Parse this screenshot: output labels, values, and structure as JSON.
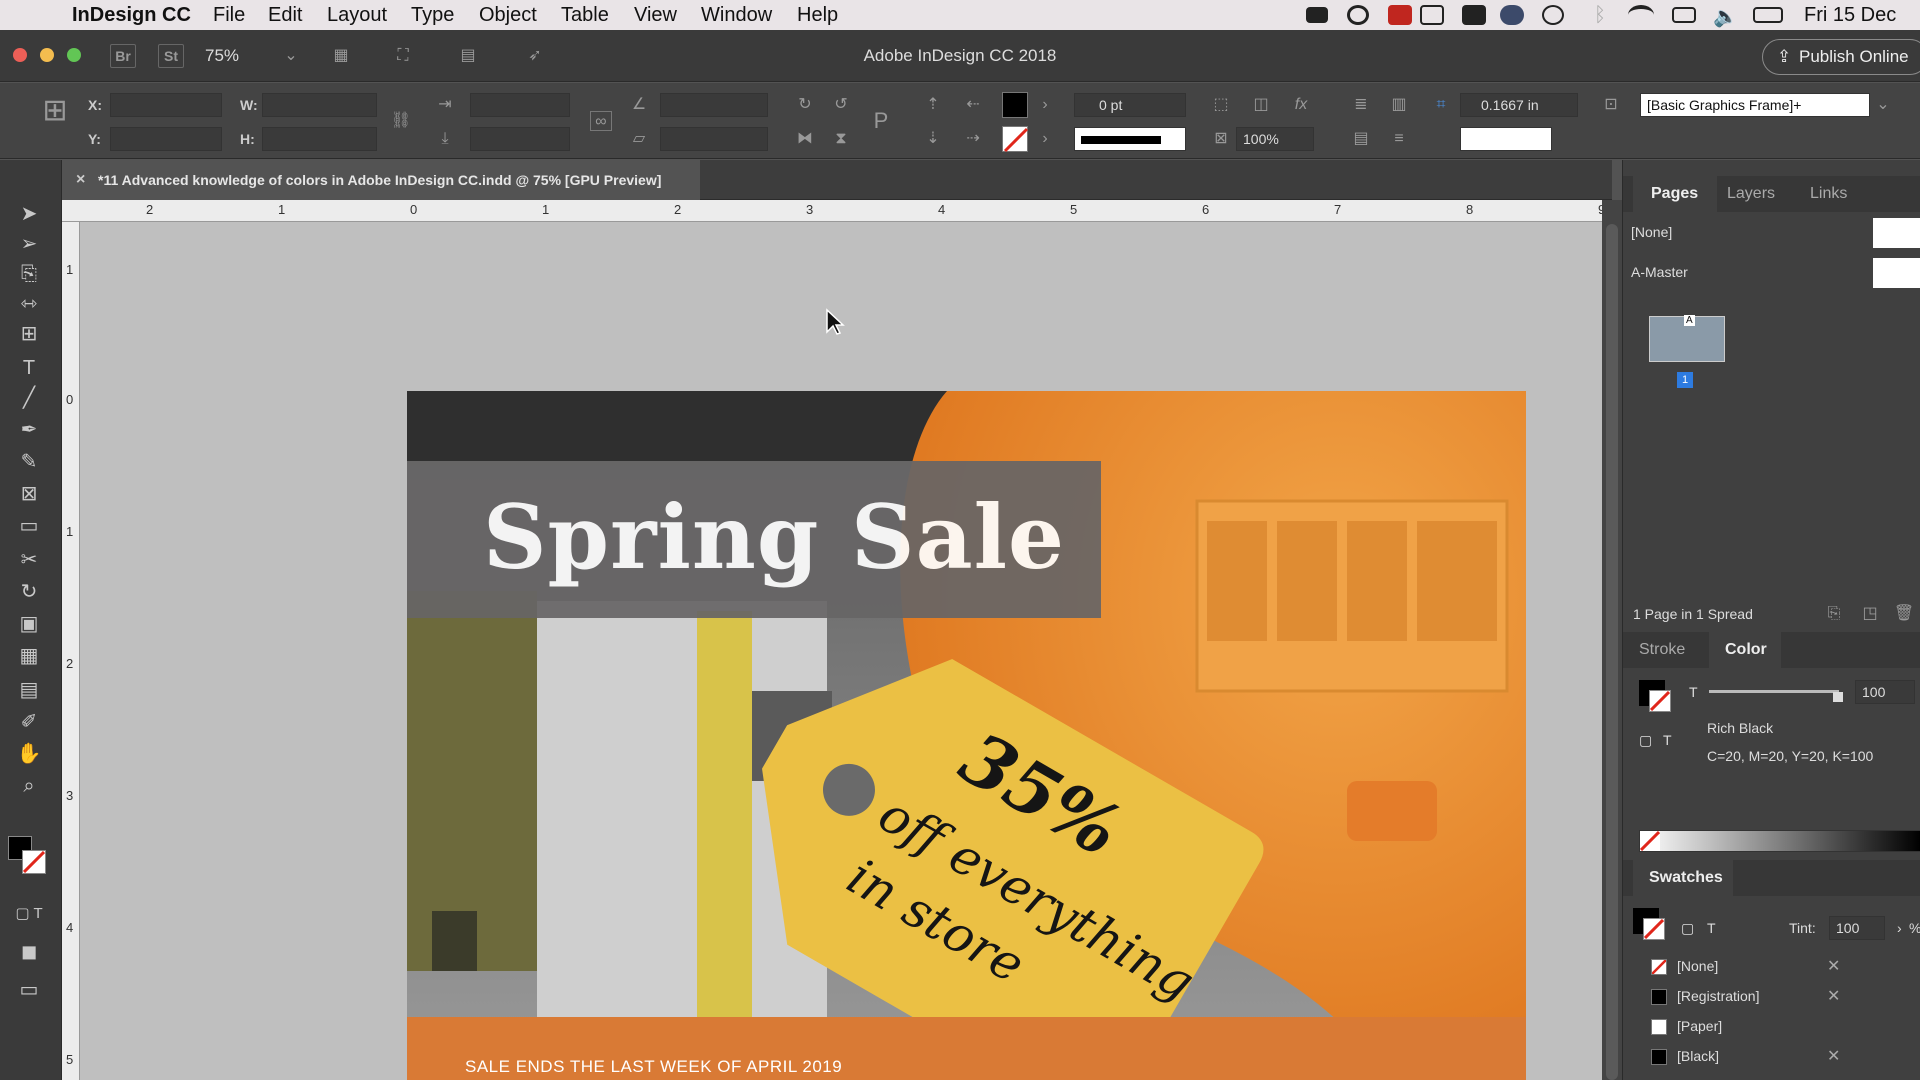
{
  "menubar": {
    "app_name": "InDesign CC",
    "items": [
      "File",
      "Edit",
      "Layout",
      "Type",
      "Object",
      "Table",
      "View",
      "Window",
      "Help"
    ],
    "clock": "Fri 15 Dec"
  },
  "titlebar": {
    "bridge": "Br",
    "stock": "St",
    "zoom": "75%",
    "title": "Adobe InDesign CC 2018",
    "publish": "Publish Online"
  },
  "control": {
    "x_label": "X:",
    "y_label": "Y:",
    "w_label": "W:",
    "h_label": "H:",
    "stroke_weight": "0 pt",
    "opacity": "100%",
    "spacing": "0.1667 in",
    "object_style": "[Basic Graphics Frame]+"
  },
  "document": {
    "tab_title": "*11 Advanced knowledge of colors in Adobe InDesign CC.indd @ 75% [GPU Preview]",
    "hruler_labels": [
      "2",
      "1",
      "0",
      "1",
      "2",
      "3",
      "4",
      "5",
      "6",
      "7",
      "8",
      "9"
    ],
    "vruler_labels": [
      "1",
      "0",
      "1",
      "2",
      "3",
      "4",
      "5"
    ]
  },
  "artwork": {
    "headline": "Spring Sale",
    "tag_percent": "35%",
    "tag_line1": "off everything",
    "tag_line2": "in store",
    "footer": "SALE ENDS THE LAST WEEK OF APRIL 2019",
    "colors": {
      "orange": "#e8902c",
      "tag_yellow": "#ebc044",
      "footer_orange": "#d97a35"
    }
  },
  "pages_panel": {
    "tabs": [
      "Pages",
      "Layers",
      "Links"
    ],
    "none_master": "[None]",
    "a_master": "A-Master",
    "page_number": "1",
    "master_letter": "A",
    "status": "1 Page in 1 Spread"
  },
  "color_panel": {
    "tabs": [
      "Stroke",
      "Color"
    ],
    "tint_value": "100",
    "color_name": "Rich Black",
    "color_value": "C=20, M=20, Y=20, K=100",
    "t_label": "T"
  },
  "swatches_panel": {
    "title": "Swatches",
    "tint_label": "Tint:",
    "tint_value": "100",
    "percent": "%",
    "t_label": "T",
    "items": [
      "[None]",
      "[Registration]",
      "[Paper]",
      "[Black]"
    ]
  }
}
